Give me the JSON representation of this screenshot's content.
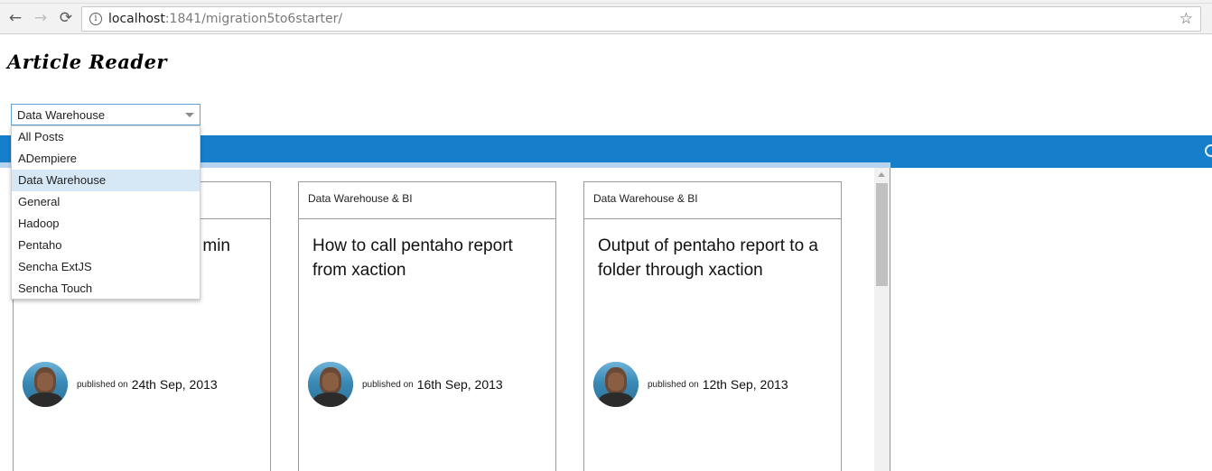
{
  "browser": {
    "back_glyph": "←",
    "forward_glyph": "→",
    "reload_glyph": "⟳",
    "info_glyph": "i",
    "url_host": "localhost",
    "url_rest": ":1841/migration5to6starter/",
    "star_glyph": "☆"
  },
  "app": {
    "title": "Article Reader"
  },
  "filter": {
    "selected": "Data Warehouse",
    "options": [
      "All Posts",
      "ADempiere",
      "Data Warehouse",
      "General",
      "Hadoop",
      "Pentaho",
      "Sencha ExtJS",
      "Sencha Touch"
    ],
    "selected_index": 2
  },
  "cards": [
    {
      "category": "",
      "title": "min",
      "published_label": "published on",
      "date": "24th Sep, 2013"
    },
    {
      "category": "Data Warehouse & BI",
      "title": "How to call pentaho report from xaction",
      "published_label": "published on",
      "date": "16th Sep, 2013"
    },
    {
      "category": "Data Warehouse & BI",
      "title": "Output of pentaho report to a folder through xaction",
      "published_label": "published on",
      "date": "12th Sep, 2013"
    }
  ],
  "colors": {
    "accent": "#157fcc",
    "selected_item": "#d6e8f6",
    "light_strip": "#b8d5ef"
  }
}
